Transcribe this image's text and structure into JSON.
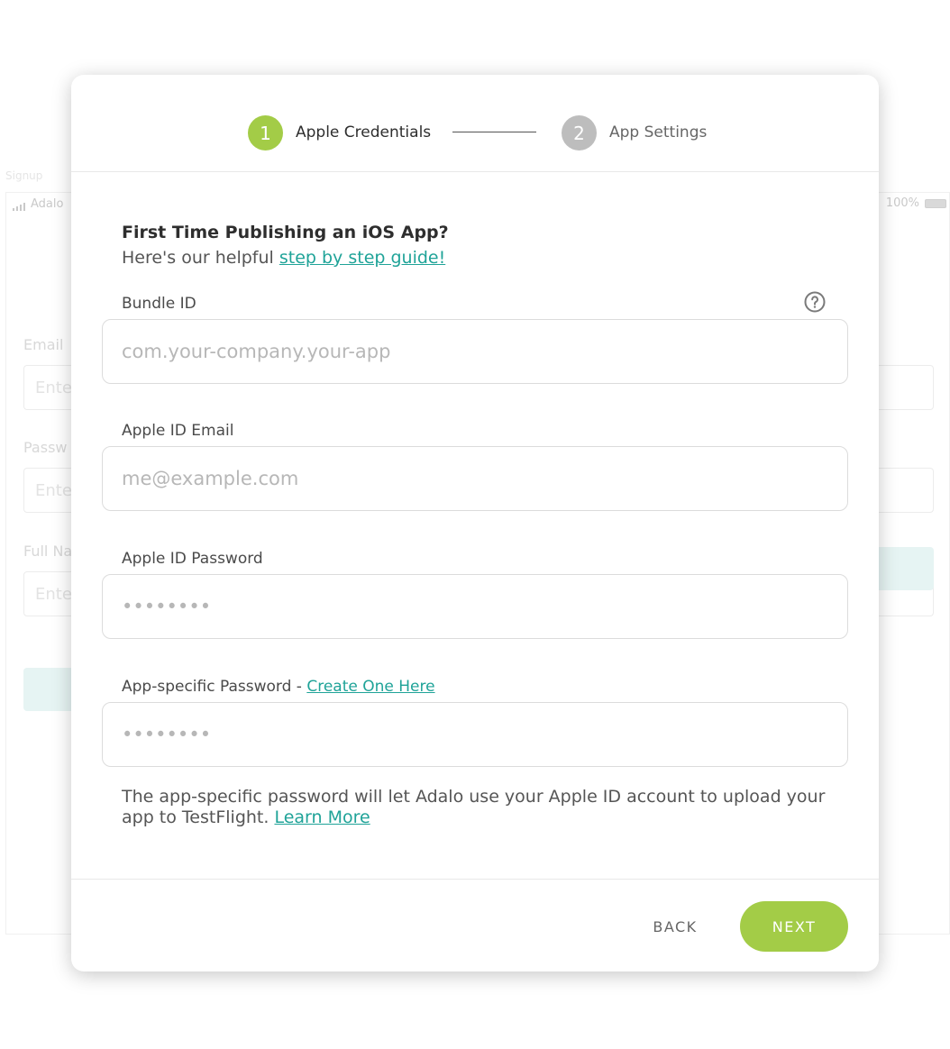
{
  "colors": {
    "accent_green": "#a3cc47",
    "inactive_step": "#bdbdbd",
    "link_teal": "#1fa398"
  },
  "background": {
    "screen_tab": "Signup",
    "status_carrier": "Adalo",
    "status_battery": "100%",
    "email_label": "Email",
    "email_placeholder": "Ente",
    "password_label": "Passw",
    "password_placeholder": "Ente",
    "fullname_label": "Full Na",
    "fullname_placeholder": "Ente"
  },
  "stepper": {
    "steps": [
      {
        "number": "1",
        "label": "Apple Credentials",
        "active": true
      },
      {
        "number": "2",
        "label": "App Settings",
        "active": false
      }
    ]
  },
  "intro": {
    "title": "First Time Publishing an iOS App?",
    "text": "Here's our helpful ",
    "link": "step by step guide!"
  },
  "fields": {
    "bundle_id": {
      "label": "Bundle ID",
      "placeholder": "com.your-company.your-app",
      "help_icon": "question-circle-icon"
    },
    "apple_id_email": {
      "label": "Apple ID Email",
      "placeholder": "me@example.com"
    },
    "apple_id_password": {
      "label": "Apple ID Password",
      "placeholder": "••••••••"
    },
    "app_specific_password": {
      "label": "App-specific Password - ",
      "link": "Create One Here",
      "placeholder": "••••••••"
    }
  },
  "note": {
    "text": "The app-specific password will let Adalo use your Apple ID account to upload your app to TestFlight. ",
    "link": "Learn More"
  },
  "footer": {
    "back_label": "BACK",
    "next_label": "NEXT"
  }
}
